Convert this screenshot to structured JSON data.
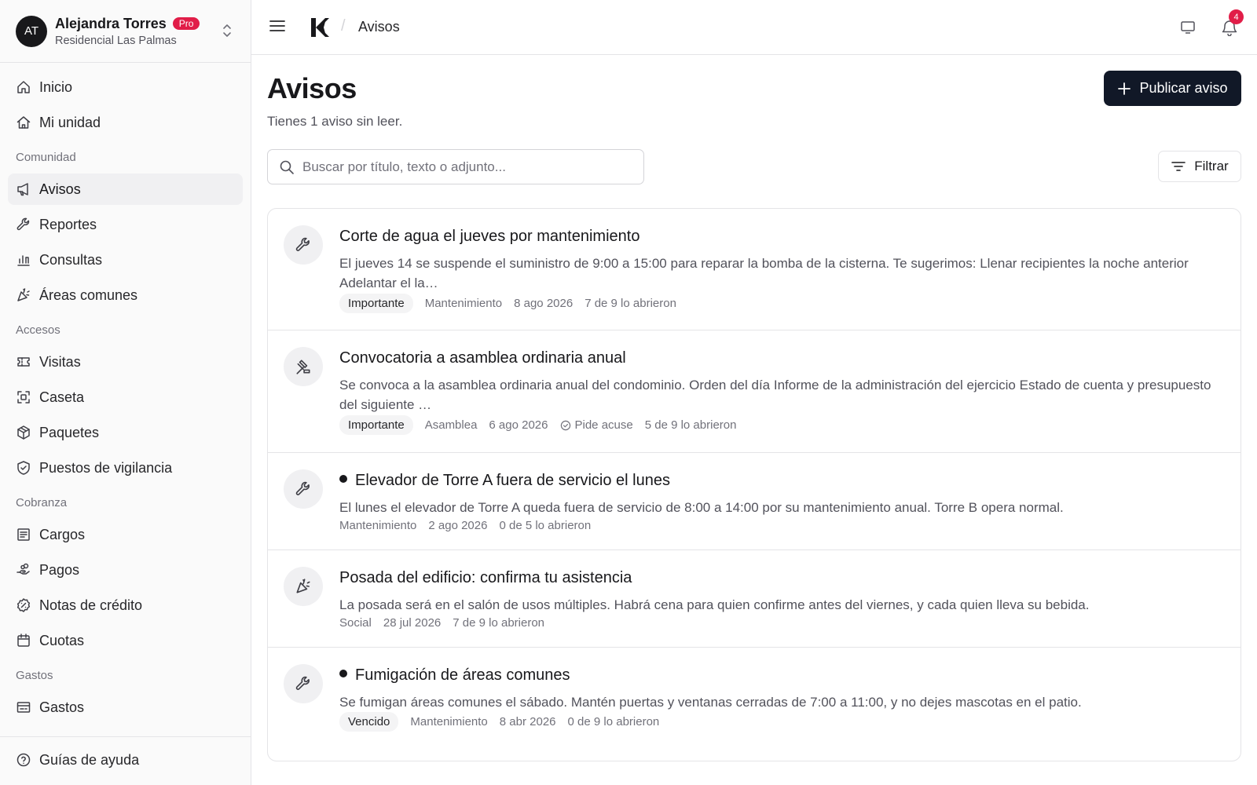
{
  "user": {
    "initials": "AT",
    "name": "Alejandra Torres",
    "badge": "Pro",
    "community": "Residencial Las Palmas"
  },
  "sidebar": {
    "top_items": [
      {
        "label": "Inicio",
        "icon": "home-icon"
      },
      {
        "label": "Mi unidad",
        "icon": "house-icon"
      }
    ],
    "sections": [
      {
        "title": "Comunidad",
        "items": [
          {
            "label": "Avisos",
            "icon": "megaphone-icon",
            "active": true
          },
          {
            "label": "Reportes",
            "icon": "wrench-icon"
          },
          {
            "label": "Consultas",
            "icon": "bar-chart-icon"
          },
          {
            "label": "Áreas comunes",
            "icon": "party-popper-icon"
          }
        ]
      },
      {
        "title": "Accesos",
        "items": [
          {
            "label": "Visitas",
            "icon": "ticket-icon"
          },
          {
            "label": "Caseta",
            "icon": "scan-icon"
          },
          {
            "label": "Paquetes",
            "icon": "package-icon"
          },
          {
            "label": "Puestos de vigilancia",
            "icon": "shield-check-icon"
          }
        ]
      },
      {
        "title": "Cobranza",
        "items": [
          {
            "label": "Cargos",
            "icon": "receipt-icon"
          },
          {
            "label": "Pagos",
            "icon": "hand-coins-icon"
          },
          {
            "label": "Notas de crédito",
            "icon": "badge-percent-icon"
          },
          {
            "label": "Cuotas",
            "icon": "calendar-icon"
          }
        ]
      },
      {
        "title": "Gastos",
        "items": [
          {
            "label": "Gastos",
            "icon": "wallet-icon"
          }
        ]
      }
    ],
    "footer": {
      "label": "Guías de ayuda",
      "icon": "help-circle-icon"
    }
  },
  "topbar": {
    "breadcrumb": "Avisos",
    "notification_count": "4"
  },
  "main": {
    "title": "Avisos",
    "subtitle": "Tienes 1 aviso sin leer.",
    "publish_label": "Publicar aviso",
    "search_placeholder": "Buscar por título, texto o adjunto...",
    "filter_label": "Filtrar"
  },
  "notices": [
    {
      "icon": "wrench-icon",
      "unread": false,
      "title": "Corte de agua el jueves por mantenimiento",
      "description": "El jueves 14 se suspende el suministro de 9:00 a 15:00 para reparar la bomba de la cisterna. Te sugerimos: Llenar recipientes la noche anterior Adelantar el la…",
      "tag": "Importante",
      "category": "Mantenimiento",
      "date": "8 ago 2026",
      "ack": "",
      "opened": "7 de 9 lo abrieron"
    },
    {
      "icon": "gavel-icon",
      "unread": false,
      "title": "Convocatoria a asamblea ordinaria anual",
      "description": "Se convoca a la asamblea ordinaria anual del condominio. Orden del día Informe de la administración del ejercicio Estado de cuenta y presupuesto del siguiente …",
      "tag": "Importante",
      "category": "Asamblea",
      "date": "6 ago 2026",
      "ack": "Pide acuse",
      "opened": "5 de 9 lo abrieron"
    },
    {
      "icon": "wrench-icon",
      "unread": true,
      "title": "Elevador de Torre A fuera de servicio el lunes",
      "description": "El lunes el elevador de Torre A queda fuera de servicio de 8:00 a 14:00 por su mantenimiento anual. Torre B opera normal.",
      "tag": "",
      "category": "Mantenimiento",
      "date": "2 ago 2026",
      "ack": "",
      "opened": "0 de 5 lo abrieron"
    },
    {
      "icon": "party-popper-icon",
      "unread": false,
      "title": "Posada del edificio: confirma tu asistencia",
      "description": "La posada será en el salón de usos múltiples. Habrá cena para quien confirme antes del viernes, y cada quien lleva su bebida.",
      "tag": "",
      "category": "Social",
      "date": "28 jul 2026",
      "ack": "",
      "opened": "7 de 9 lo abrieron"
    },
    {
      "icon": "wrench-icon",
      "unread": true,
      "title": "Fumigación de áreas comunes",
      "description": "Se fumigan áreas comunes el sábado. Mantén puertas y ventanas cerradas de 7:00 a 11:00, y no dejes mascotas en el patio.",
      "tag": "Vencido",
      "category": "Mantenimiento",
      "date": "8 abr 2026",
      "ack": "",
      "opened": "0 de 9 lo abrieron"
    }
  ]
}
